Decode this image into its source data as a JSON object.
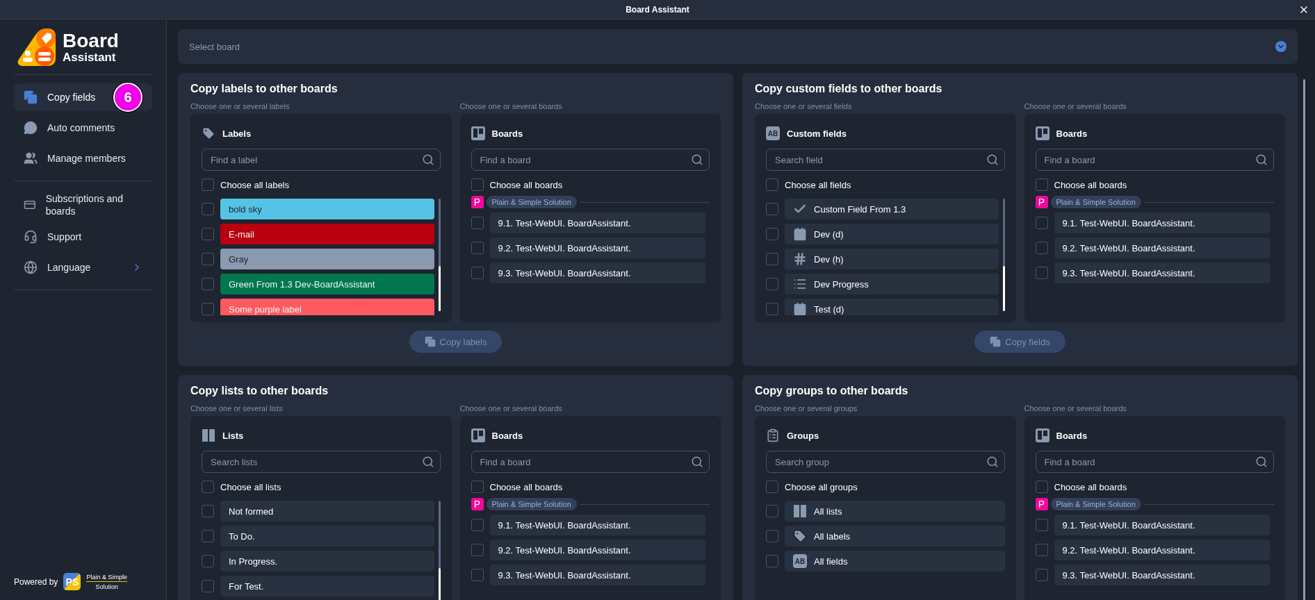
{
  "window": {
    "title": "Board Assistant"
  },
  "sidebar": {
    "logo": {
      "line_1": "Board",
      "line_2": "Assistant"
    },
    "groups": [
      [
        {
          "label": "Copy fields",
          "selected": true,
          "badge": "6",
          "submenu": false
        },
        {
          "label": "Auto comments",
          "selected": false,
          "submenu": false
        },
        {
          "label": "Manage members",
          "selected": false,
          "submenu": false
        }
      ],
      [
        {
          "label": "Subscriptions and boards",
          "selected": false,
          "submenu": false
        },
        {
          "label": "Support",
          "selected": false,
          "submenu": false
        },
        {
          "label": "Language",
          "selected": false,
          "submenu": true
        }
      ]
    ],
    "footer": {
      "powered_by": "Powered by",
      "mark": "PS",
      "brand_line_1": "Plain & Simple",
      "brand_line_2": "Solution"
    }
  },
  "board_select": {
    "placeholder": "Select board"
  },
  "sections": [
    {
      "title": "Copy labels to other boards",
      "button": {
        "label": "Copy labels",
        "disabled": true
      },
      "source": {
        "hint": "Choose one or several labels",
        "title": "Labels",
        "placeholder": "Find a label",
        "choose_all": "Choose all labels",
        "checked": false,
        "items": [
          {
            "kind": "label",
            "text": "bold sky",
            "color": "#55c4e4",
            "checked": false
          },
          {
            "kind": "label",
            "text": "E-mail",
            "color": "#b8000f",
            "checked": false
          },
          {
            "kind": "label",
            "text": "Gray",
            "color": "#8a9ab0",
            "checked": false
          },
          {
            "kind": "label",
            "text": "Green From 1.3 Dev-BoardAssistant",
            "color": "#00774e",
            "checked": false
          },
          {
            "kind": "label",
            "text": "Some purple label",
            "color": "#ff5a5f",
            "checked": false
          }
        ]
      },
      "target": {
        "hint": "Choose one or several boards",
        "title": "Boards",
        "placeholder": "Find a board",
        "choose_all": "Choose all boards",
        "checked": false,
        "org": {
          "badge": "P",
          "name": "Plain & Simple Solution"
        },
        "items": [
          {
            "kind": "plain",
            "text": "9.1. Test-WebUI. BoardAssistant.",
            "checked": false
          },
          {
            "kind": "plain",
            "text": "9.2. Test-WebUI. BoardAssistant.",
            "checked": false
          },
          {
            "kind": "plain",
            "text": "9.3. Test-WebUI. BoardAssistant.",
            "checked": false
          }
        ]
      }
    },
    {
      "title": "Copy custom fields to other boards",
      "button": {
        "label": "Copy fields",
        "disabled": true
      },
      "source": {
        "hint": "Choose one or several fields",
        "icon_label": "AB",
        "title": "Custom fields",
        "placeholder": "Search field",
        "choose_all": "Choose all fields",
        "checked": false,
        "items": [
          {
            "kind": "checkbox",
            "text": "Custom Field From 1.3",
            "checked": false
          },
          {
            "kind": "date",
            "text": "Dev (d)",
            "checked": false
          },
          {
            "kind": "number",
            "text": "Dev (h)",
            "checked": false
          },
          {
            "kind": "dropdown",
            "text": "Dev Progress",
            "checked": false
          },
          {
            "kind": "date",
            "text": "Test (d)",
            "checked": false
          }
        ]
      },
      "target": {
        "hint": "Choose one or several boards",
        "title": "Boards",
        "placeholder": "Find a board",
        "choose_all": "Choose all boards",
        "checked": false,
        "org": {
          "badge": "P",
          "name": "Plain & Simple Solution"
        },
        "items": [
          {
            "kind": "plain",
            "text": "9.1. Test-WebUI. BoardAssistant.",
            "checked": false
          },
          {
            "kind": "plain",
            "text": "9.2. Test-WebUI. BoardAssistant.",
            "checked": false
          },
          {
            "kind": "plain",
            "text": "9.3. Test-WebUI. BoardAssistant.",
            "checked": false
          }
        ]
      }
    },
    {
      "title": "Copy lists to other boards",
      "source": {
        "hint": "Choose one or several lists",
        "title": "Lists",
        "placeholder": "Search lists",
        "choose_all": "Choose all lists",
        "checked": false,
        "items": [
          {
            "kind": "plain",
            "text": "Not formed",
            "checked": false
          },
          {
            "kind": "plain",
            "text": "To Do.",
            "checked": false
          },
          {
            "kind": "plain",
            "text": "In Progress.",
            "checked": false
          },
          {
            "kind": "plain",
            "text": "For Test.",
            "checked": false
          }
        ]
      },
      "target": {
        "hint": "Choose one or several boards",
        "title": "Boards",
        "placeholder": "Find a board",
        "choose_all": "Choose all boards",
        "checked": false,
        "org": {
          "badge": "P",
          "name": "Plain & Simple Solution"
        },
        "items": [
          {
            "kind": "plain",
            "text": "9.1. Test-WebUI. BoardAssistant.",
            "checked": false
          },
          {
            "kind": "plain",
            "text": "9.2. Test-WebUI. BoardAssistant.",
            "checked": false
          },
          {
            "kind": "plain",
            "text": "9.3. Test-WebUI. BoardAssistant.",
            "checked": false
          }
        ]
      }
    },
    {
      "title": "Copy groups to other boards",
      "source": {
        "hint": "Choose one or several groups",
        "title": "Groups",
        "placeholder": "Search group",
        "choose_all": "Choose all groups",
        "checked": false,
        "items": [
          {
            "kind": "lists",
            "text": "All lists",
            "checked": false
          },
          {
            "kind": "labels",
            "text": "All labels",
            "checked": false
          },
          {
            "kind": "fields",
            "icon_label": "AB",
            "text": "All fields",
            "checked": false
          }
        ]
      },
      "target": {
        "hint": "Choose one or several boards",
        "title": "Boards",
        "placeholder": "Find a board",
        "choose_all": "Choose all boards",
        "checked": false,
        "org": {
          "badge": "P",
          "name": "Plain & Simple Solution"
        },
        "items": [
          {
            "kind": "plain",
            "text": "9.1. Test-WebUI. BoardAssistant.",
            "checked": false
          },
          {
            "kind": "plain",
            "text": "9.2. Test-WebUI. BoardAssistant.",
            "checked": false
          },
          {
            "kind": "plain",
            "text": "9.3. Test-WebUI. BoardAssistant.",
            "checked": false
          }
        ]
      }
    }
  ]
}
